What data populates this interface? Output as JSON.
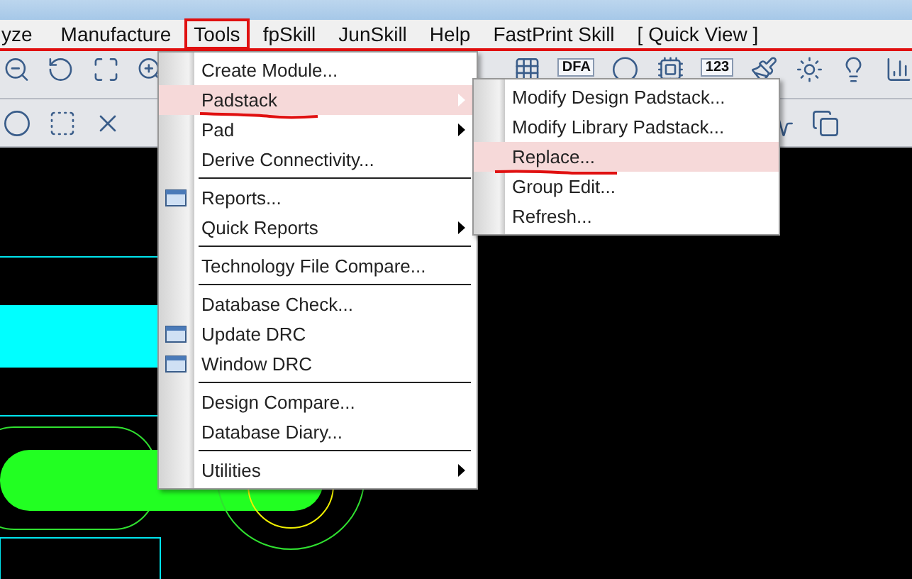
{
  "menubar": [
    {
      "label": "yze",
      "marked": false
    },
    {
      "label": "Manufacture",
      "marked": false
    },
    {
      "label": "Tools",
      "marked": true
    },
    {
      "label": "fpSkill",
      "marked": false
    },
    {
      "label": "JunSkill",
      "marked": false
    },
    {
      "label": "Help",
      "marked": false
    },
    {
      "label": "FastPrint Skill",
      "marked": false
    },
    {
      "label": "[ Quick View ]",
      "marked": false
    }
  ],
  "toolbar": {
    "text_buttons": [
      "DFA",
      "123"
    ]
  },
  "tools_menu": {
    "groups": [
      [
        {
          "label": "Create Module...",
          "kind": "plain",
          "has_submenu": false,
          "selected": false,
          "marked": false
        },
        {
          "label": "Padstack",
          "kind": "plain",
          "has_submenu": true,
          "selected": true,
          "marked": true
        },
        {
          "label": "Pad",
          "kind": "plain",
          "has_submenu": true,
          "selected": false,
          "marked": false
        },
        {
          "label": "Derive Connectivity...",
          "kind": "plain",
          "has_submenu": false,
          "selected": false,
          "marked": false
        }
      ],
      [
        {
          "label": "Reports...",
          "kind": "icon",
          "has_submenu": false,
          "selected": false,
          "marked": false
        },
        {
          "label": "Quick Reports",
          "kind": "plain",
          "has_submenu": true,
          "selected": false,
          "marked": false
        }
      ],
      [
        {
          "label": "Technology File Compare...",
          "kind": "plain",
          "has_submenu": false,
          "selected": false,
          "marked": false
        }
      ],
      [
        {
          "label": "Database Check...",
          "kind": "plain",
          "has_submenu": false,
          "selected": false,
          "marked": false
        },
        {
          "label": "Update DRC",
          "kind": "icon",
          "has_submenu": false,
          "selected": false,
          "marked": false
        },
        {
          "label": "Window DRC",
          "kind": "icon",
          "has_submenu": false,
          "selected": false,
          "marked": false
        }
      ],
      [
        {
          "label": "Design Compare...",
          "kind": "plain",
          "has_submenu": false,
          "selected": false,
          "marked": false
        },
        {
          "label": "Database Diary...",
          "kind": "plain",
          "has_submenu": false,
          "selected": false,
          "marked": false
        }
      ],
      [
        {
          "label": "Utilities",
          "kind": "plain",
          "has_submenu": true,
          "selected": false,
          "marked": false
        }
      ]
    ]
  },
  "padstack_submenu": {
    "items": [
      {
        "label": "Modify Design Padstack...",
        "selected": false,
        "marked": false
      },
      {
        "label": "Modify Library Padstack...",
        "selected": false,
        "marked": false
      },
      {
        "label": "Replace...",
        "selected": true,
        "marked": true
      },
      {
        "label": "Group Edit...",
        "selected": false,
        "marked": false
      },
      {
        "label": "Refresh...",
        "selected": false,
        "marked": false
      }
    ]
  }
}
